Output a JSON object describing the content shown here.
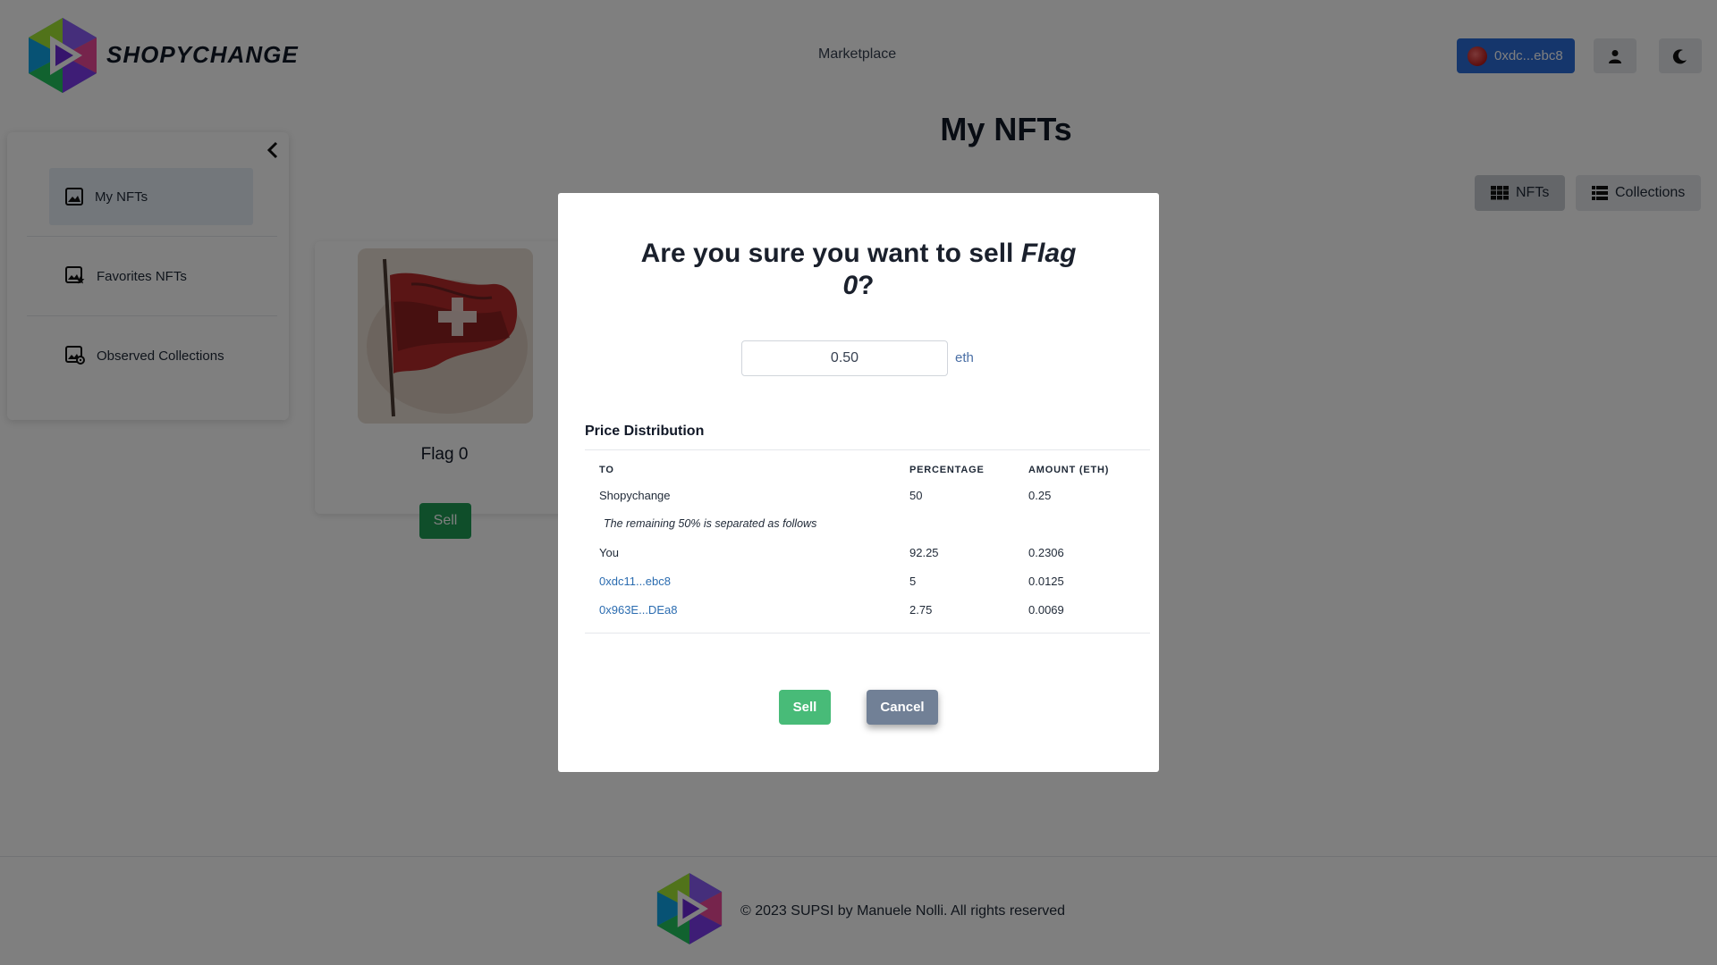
{
  "header": {
    "brand": "SHOPYCHANGE",
    "nav_marketplace": "Marketplace",
    "wallet_label": "0xdc...ebc8",
    "profile_icon": "user-icon",
    "theme_icon": "moon-icon"
  },
  "sidebar": {
    "items": [
      {
        "label": "My NFTs",
        "icon": "image-icon",
        "active": true
      },
      {
        "label": "Favorites NFTs",
        "icon": "image-star-icon",
        "active": false
      },
      {
        "label": "Observed Collections",
        "icon": "image-gear-icon",
        "active": false
      }
    ]
  },
  "main": {
    "title": "My NFTs",
    "view_nfts_label": "NFTs",
    "view_collections_label": "Collections",
    "nft_card": {
      "name": "Flag 0",
      "sell_label": "Sell"
    }
  },
  "modal": {
    "title_prefix": "Are you sure you want to sell ",
    "title_item": "Flag 0",
    "title_suffix": "?",
    "price_value": "0.50",
    "price_unit": "eth",
    "distribution_title": "Price Distribution",
    "columns": [
      "TO",
      "PERCENTAGE",
      "AMOUNT (ETH)"
    ],
    "rows": [
      {
        "to": "Shopychange",
        "percentage": "50",
        "amount": "0.25"
      }
    ],
    "note": "The remaining 50% is separated as follows",
    "split_rows": [
      {
        "to": "You",
        "percentage": "92.25",
        "amount": "0.2306"
      },
      {
        "to": "0xdc11...ebc8",
        "percentage": "5",
        "amount": "0.0125"
      },
      {
        "to": "0x963E...DEa8",
        "percentage": "2.75",
        "amount": "0.0069"
      }
    ],
    "sell_label": "Sell",
    "cancel_label": "Cancel"
  },
  "footer": {
    "text": "© 2023 SUPSI by Manuele Nolli. All rights reserved"
  },
  "colors": {
    "primary": "#2b6cd8",
    "sell_green": "#48bb78",
    "cancel_gray": "#718096",
    "overlay": "rgba(0,0,0,0.5)"
  }
}
